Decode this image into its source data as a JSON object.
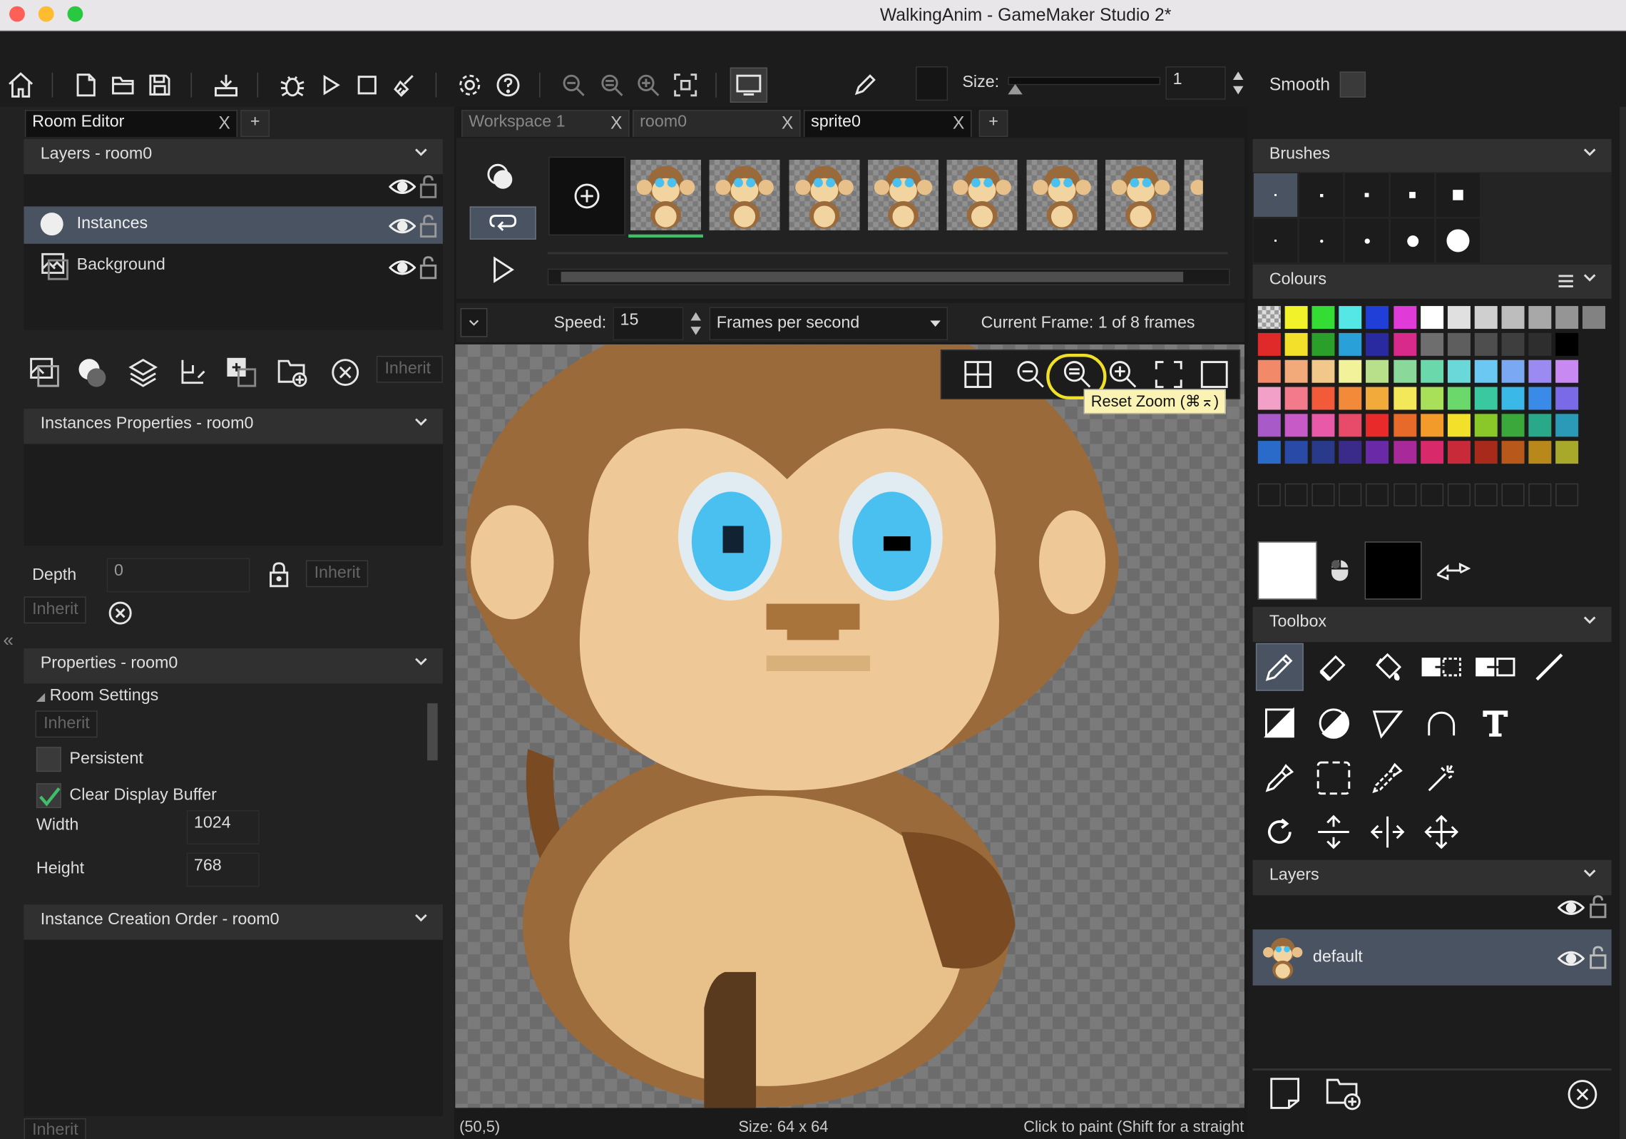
{
  "window": {
    "title": "WalkingAnim - GameMaker Studio 2*"
  },
  "toolbar": {
    "size_label": "Size:",
    "size_value": "1",
    "smooth_label": "Smooth"
  },
  "left_tabs": [
    {
      "label": "Room Editor"
    }
  ],
  "editor_tabs": [
    {
      "label": "Workspace 1"
    },
    {
      "label": "room0"
    },
    {
      "label": "sprite0"
    }
  ],
  "layers_panel": {
    "title": "Layers - room0",
    "items": [
      {
        "label": "Instances"
      },
      {
        "label": "Background"
      }
    ],
    "inherit_label": "Inherit"
  },
  "instances_properties": {
    "title": "Instances Properties - room0",
    "depth_label": "Depth",
    "depth_value": "0",
    "inherit_label": "Inherit"
  },
  "properties": {
    "title": "Properties - room0",
    "section": "Room Settings",
    "inherit_label": "Inherit",
    "persistent_label": "Persistent",
    "persistent_checked": false,
    "clear_buffer_label": "Clear Display Buffer",
    "clear_buffer_checked": true,
    "width_label": "Width",
    "width_value": "1024",
    "height_label": "Height",
    "height_value": "768"
  },
  "creation_order": {
    "title": "Instance Creation Order - room0",
    "inherit_label": "Inherit"
  },
  "sprite_editor": {
    "speed_label": "Speed:",
    "speed_value": "15",
    "speed_unit": "Frames per second",
    "current_frame": "Current Frame: 1 of 8 frames",
    "tooltip": "Reset Zoom (⌘⌅)"
  },
  "status_bar": {
    "coords": "(50,5)",
    "size": "Size: 64 x 64",
    "hint": "Click to paint (Shift for a straight line, Ctrl to pick a colour)"
  },
  "brushes_panel": {
    "title": "Brushes"
  },
  "colours_panel": {
    "title": "Colours",
    "rows": [
      [
        "#f2f22a",
        "#33dd33",
        "#55e6e6",
        "#1f3fd8",
        "#e03ad8",
        "#ffffff",
        "#e0e0e0",
        "#cfcfcf",
        "#bdbdbd",
        "#a8a8a8",
        "#959595",
        "#828282"
      ],
      [
        "#e02a2a",
        "#f2e02a",
        "#2aa02a",
        "#2aa0d8",
        "#2a2aa0",
        "#d82a8a",
        "#6e6e6e",
        "#5e5e5e",
        "#4e4e4e",
        "#3e3e3e",
        "#2e2e2e",
        "#000000"
      ],
      [
        "#f28a6a",
        "#f2aa7a",
        "#f2c88a",
        "#f2f29a",
        "#b8e08a",
        "#8ad89a",
        "#6ad8aa",
        "#6ad8d8",
        "#6ac8f2",
        "#7aa8f2",
        "#9a8af2",
        "#c88af2"
      ],
      [
        "#f2a0c8",
        "#f27a8a",
        "#f25a3a",
        "#f28a3a",
        "#f2aa3a",
        "#f2e85a",
        "#a8e05a",
        "#6ad86a",
        "#3ac8a0",
        "#3ab8e8",
        "#3a8ae8",
        "#7a6ae8"
      ],
      [
        "#a85ac8",
        "#c85ac8",
        "#e85aa8",
        "#e84a6a",
        "#e82a2a",
        "#e86a2a",
        "#f29a2a",
        "#f2e02a",
        "#8ac82a",
        "#3aa83a",
        "#2aa88a",
        "#2a9ab8"
      ],
      [
        "#2a6ac8",
        "#2a4aa8",
        "#2a3a8a",
        "#3a2a8a",
        "#6a2aa8",
        "#a82a9a",
        "#d82a6a",
        "#c82a3a",
        "#a82a1a",
        "#b8581a",
        "#b8881a",
        "#a8a82a"
      ]
    ]
  },
  "toolbox_panel": {
    "title": "Toolbox"
  },
  "sprite_layers_panel": {
    "title": "Layers",
    "items": [
      {
        "label": "default"
      }
    ]
  }
}
